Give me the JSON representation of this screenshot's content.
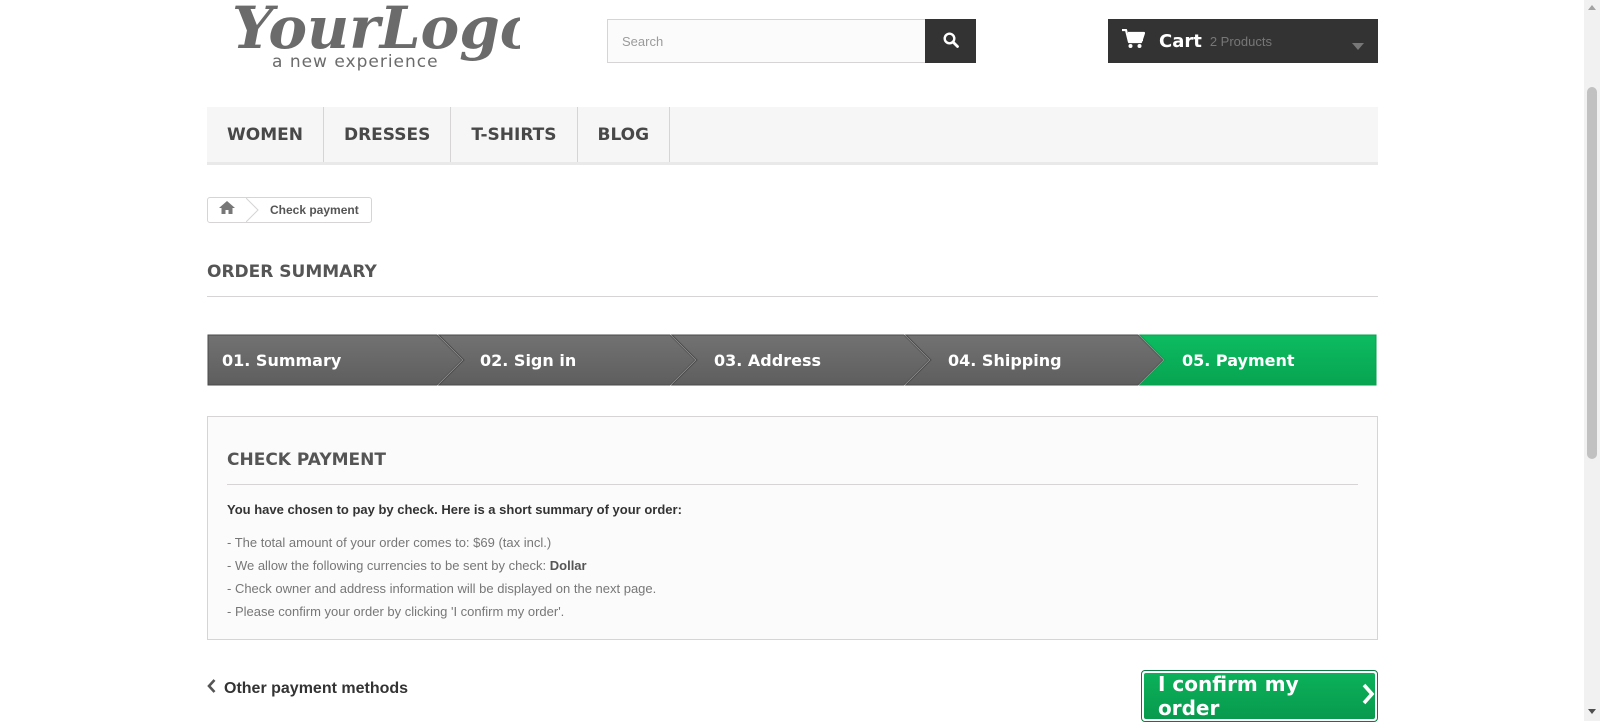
{
  "header": {
    "logo_text": "YourLogo",
    "logo_tagline": "a new experience",
    "search": {
      "placeholder": "Search"
    },
    "cart": {
      "label": "Cart",
      "count": "2 Products"
    }
  },
  "menu": {
    "items": [
      {
        "label": "Women"
      },
      {
        "label": "Dresses"
      },
      {
        "label": "T-shirts"
      },
      {
        "label": "Blog"
      }
    ]
  },
  "breadcrumb": {
    "current": "Check payment"
  },
  "page_title": "Order summary",
  "steps": [
    {
      "label": "01. Summary",
      "state": "done"
    },
    {
      "label": "02. Sign in",
      "state": "done"
    },
    {
      "label": "03. Address",
      "state": "done"
    },
    {
      "label": "04. Shipping",
      "state": "done"
    },
    {
      "label": "05. Payment",
      "state": "current"
    }
  ],
  "payment_box": {
    "title": "Check payment",
    "lead": "You have chosen to pay by check. Here is a short summary of your order:",
    "line_total": "- The total amount of your order comes to: $69 (tax incl.)",
    "line_currency_prefix": "- We allow the following currencies to be sent by check: ",
    "line_currency_value": "Dollar",
    "line_owner": "- Check owner and address information will be displayed on the next page.",
    "line_confirm": "- Please confirm your order by clicking 'I confirm my order'."
  },
  "actions": {
    "other_methods": "Other payment methods",
    "confirm": "I confirm my order"
  },
  "colors": {
    "accent_green": "#0bb15a",
    "step_gray": "#666666",
    "dark": "#333333"
  }
}
